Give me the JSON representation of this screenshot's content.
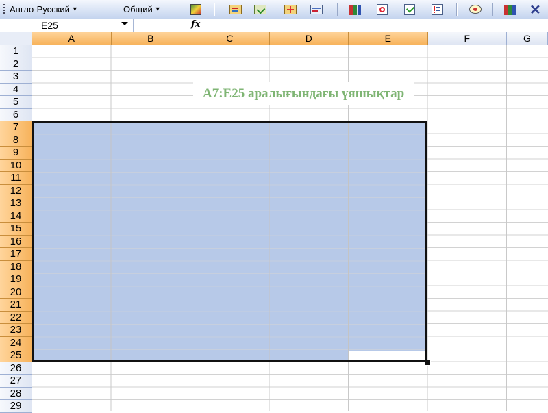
{
  "toolbar": {
    "language_dropdown": "Англо-Русский",
    "style_dropdown": "Общий",
    "buttons": [
      {
        "icon": "translate-icon"
      },
      {
        "icon": "dictionary-icon"
      },
      {
        "icon": "dictionary-check-icon"
      },
      {
        "icon": "dictionary-add-icon"
      },
      {
        "icon": "dictionary-edit-icon"
      },
      {
        "icon": "books-icon"
      },
      {
        "icon": "search-page-icon"
      },
      {
        "icon": "check-doc-icon"
      },
      {
        "icon": "warning-list-icon"
      },
      {
        "icon": "comment-icon"
      },
      {
        "icon": "books-icon"
      },
      {
        "icon": "close-icon"
      }
    ]
  },
  "formula_bar": {
    "name_box": "E25",
    "fx_label": "fx",
    "formula": ""
  },
  "columns": [
    "A",
    "B",
    "C",
    "D",
    "E",
    "F",
    "G"
  ],
  "selected_columns": [
    "A",
    "B",
    "C",
    "D",
    "E"
  ],
  "rows": [
    "1",
    "2",
    "3",
    "4",
    "5",
    "6",
    "7",
    "8",
    "9",
    "10",
    "11",
    "12",
    "13",
    "14",
    "15",
    "16",
    "17",
    "18",
    "19",
    "20",
    "21",
    "22",
    "23",
    "24",
    "25",
    "26",
    "27",
    "28",
    "29"
  ],
  "selected_rows": [
    "7",
    "8",
    "9",
    "10",
    "11",
    "12",
    "13",
    "14",
    "15",
    "16",
    "17",
    "18",
    "19",
    "20",
    "21",
    "22",
    "23",
    "24",
    "25"
  ],
  "selection": {
    "range": "A7:E25",
    "active_cell": "E25",
    "fill_color": "#b7c9e8"
  },
  "caption": "А7:Е25 аралығындағы ұяшықтар",
  "colors": {
    "selected_header": "#f7b35c",
    "caption_text": "#7fb574"
  }
}
